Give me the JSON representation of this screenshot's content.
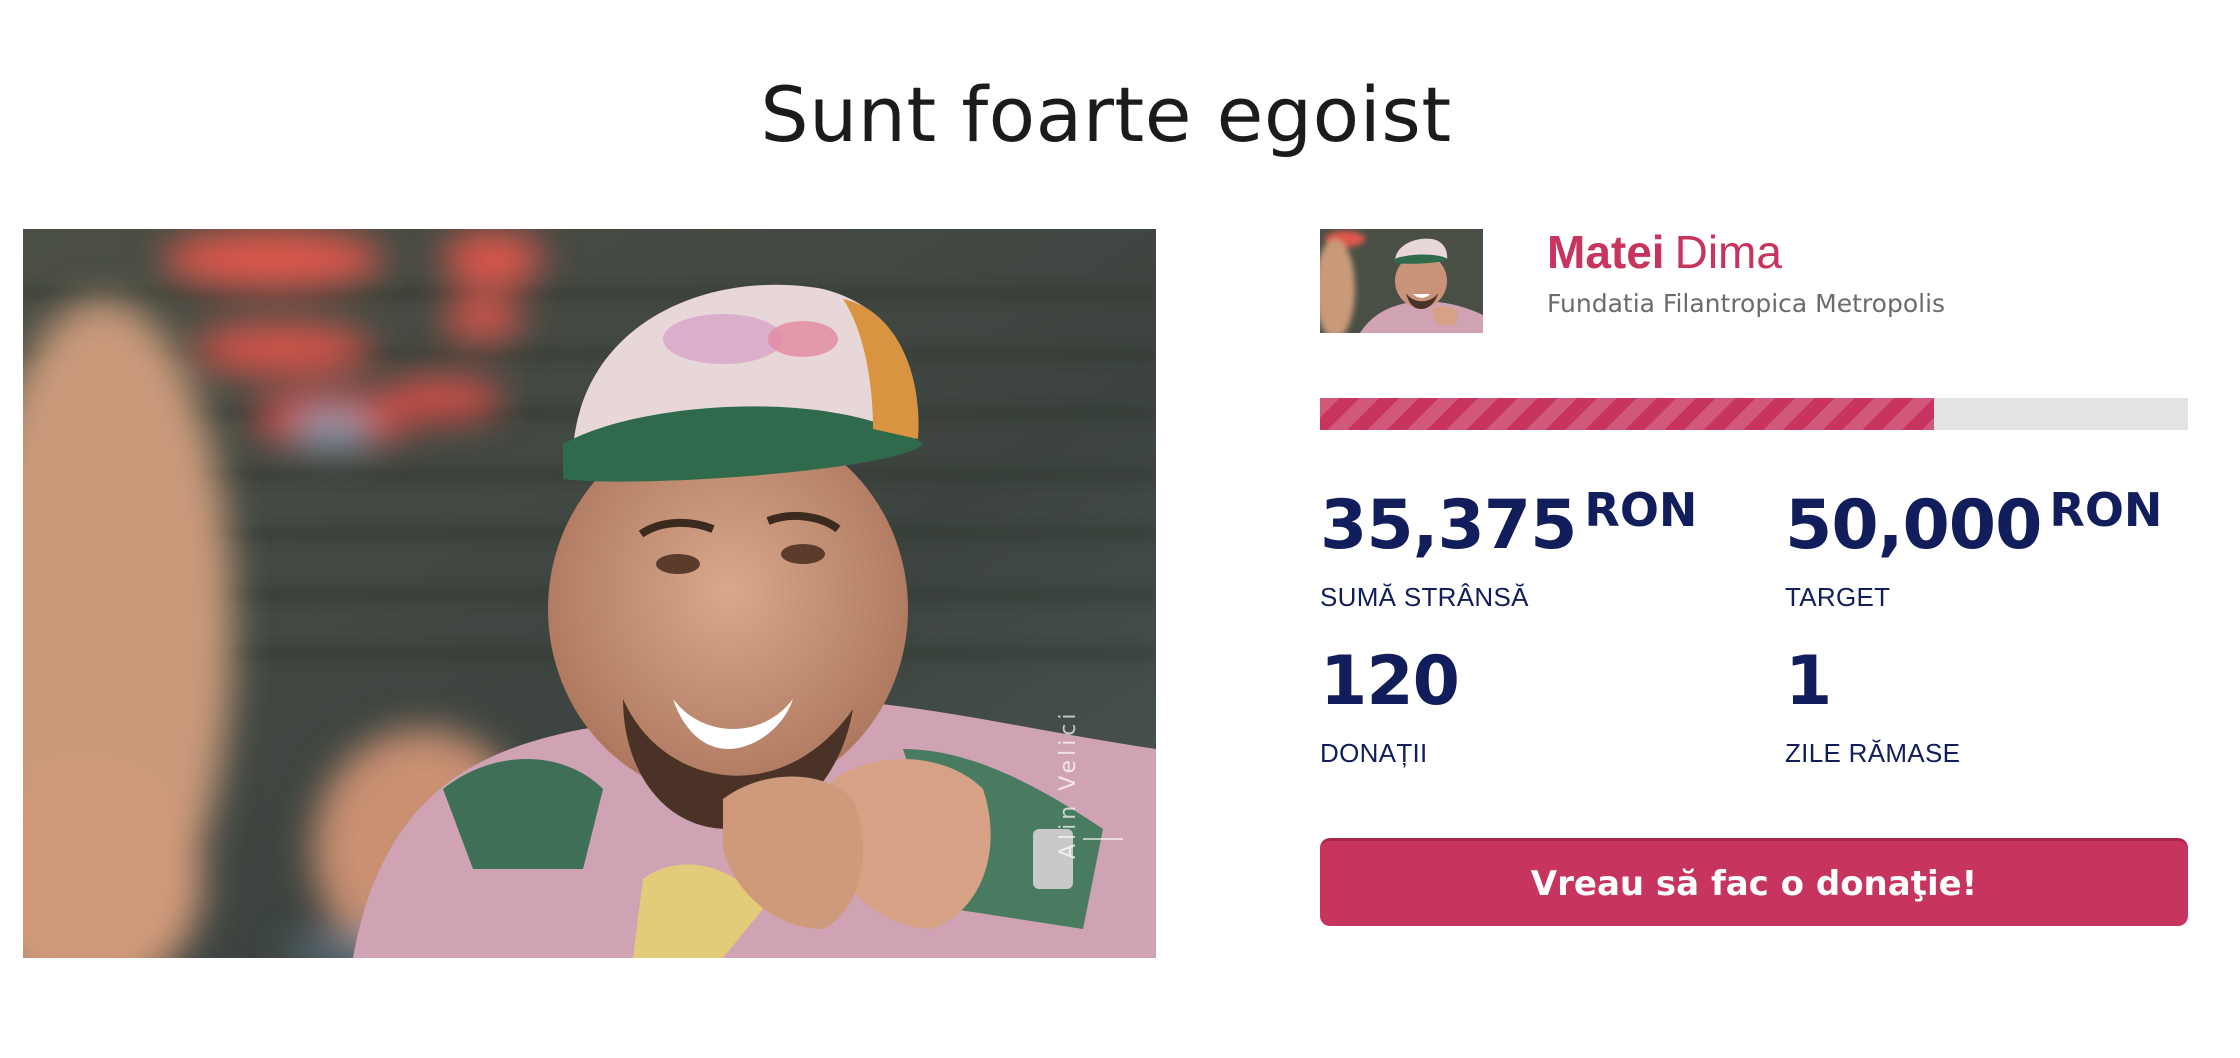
{
  "page": {
    "title": "Sunt foarte egoist"
  },
  "campaigner": {
    "first_name": "Matei",
    "last_name": "Dima",
    "organization": "Fundatia Filantropica Metropolis"
  },
  "progress": {
    "raised_fraction": 0.7075,
    "fill_color": "#c7345d",
    "track_color": "#e3e3e6"
  },
  "stats": {
    "raised": {
      "value": "35,375",
      "unit": "RON",
      "label": "SUMĂ STRÂNSĂ"
    },
    "target": {
      "value": "50,000",
      "unit": "RON",
      "label": "TARGET"
    },
    "donations": {
      "value": "120",
      "label": "DONAȚII"
    },
    "days_left": {
      "value": "1",
      "label": "ZILE RĂMASE"
    }
  },
  "cta": {
    "donate_label": "Vreau să fac o donaţie!"
  },
  "colors": {
    "accent": "#c7345d",
    "navy": "#121d5b"
  }
}
